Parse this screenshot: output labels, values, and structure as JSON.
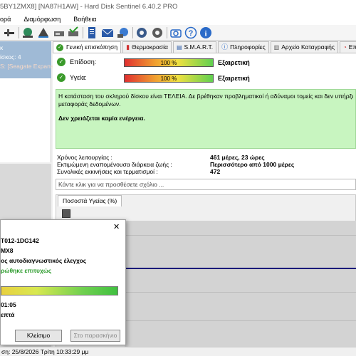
{
  "titlebar": {
    "text": "5BY1ZMX8]  [NA87H1AW] - Hard Disk Sentinel 6.40.2 PRO"
  },
  "menu": {
    "items": [
      "ορά",
      "Διαμόρφωση",
      "Βοήθεια"
    ]
  },
  "left": {
    "line1": "κ",
    "line2": "ίσκος: 4",
    "line3": "S: [Seagate Expansio"
  },
  "tabs": [
    {
      "label": "Γενική επισκόπηση",
      "icon": "check-icon"
    },
    {
      "label": "Θερμοκρασία",
      "icon": "thermometer-icon"
    },
    {
      "label": "S.M.A.R.T.",
      "icon": "smart-icon"
    },
    {
      "label": "Πληροφορίες",
      "icon": "info-icon"
    },
    {
      "label": "Αρχείο Καταγραφής",
      "icon": "log-icon"
    },
    {
      "label": "Επιδ",
      "icon": "performance-icon"
    }
  ],
  "overview": {
    "performance_label": "Επίδοση:",
    "performance_pct": "100 %",
    "performance_value": 1.0,
    "performance_status": "Εξαιρετική",
    "health_label": "Υγεία:",
    "health_pct": "100 %",
    "health_value": 1.0,
    "health_status": "Εξαιρετική",
    "message_line1": "Η κατάσταση του σκληρού δίσκου είναι ΤΕΛΕΙΑ. Δε βρέθηκαν προβληματικοί ή αδύναμοι τομείς και δεν υπήρξε σφάλμα",
    "message_line2": "μεταφοράς δεδομένων.",
    "message_action": "Δεν χρειάζεται καμία ενέργεια.",
    "uptime_label": "Χρόνος λειτουργίας :",
    "uptime_value": "461 μέρες, 23 ώρες",
    "lifetime_label": "Εκτιμώμενη εναπομένουσα διάρκεια ζωής :",
    "lifetime_value": "Περισσότερο από 1000 μέρες",
    "startstop_label": "Συνολικές εκκινήσεις και τερματισμοί :",
    "startstop_value": "472",
    "comment_placeholder": "Κάντε κλικ για να προσθέσετε σχόλιο ...",
    "graph_tab": "Ποσοστά Υγείας (%)"
  },
  "dialog": {
    "model": "T012-1DG142",
    "serial": "MX8",
    "test_name": "ος αυτοδιαγνωστικός έλεγχος",
    "test_result": "ρώθηκε επιτυχώς",
    "progress_value": 1.0,
    "time": "01:05",
    "minutes": "επτά",
    "close_button": "Κλείσιμο",
    "background_button": "Στο παρασκήνιο"
  },
  "statusbar": {
    "text": "ση: 25/8/2026 Τρίτη 10:33:29 μμ"
  },
  "colors": {
    "accent": "#9fbad6",
    "ok": "#3a9a2a",
    "message_bg": "#c8f5c0",
    "graph_line": "#1a1a7a"
  }
}
